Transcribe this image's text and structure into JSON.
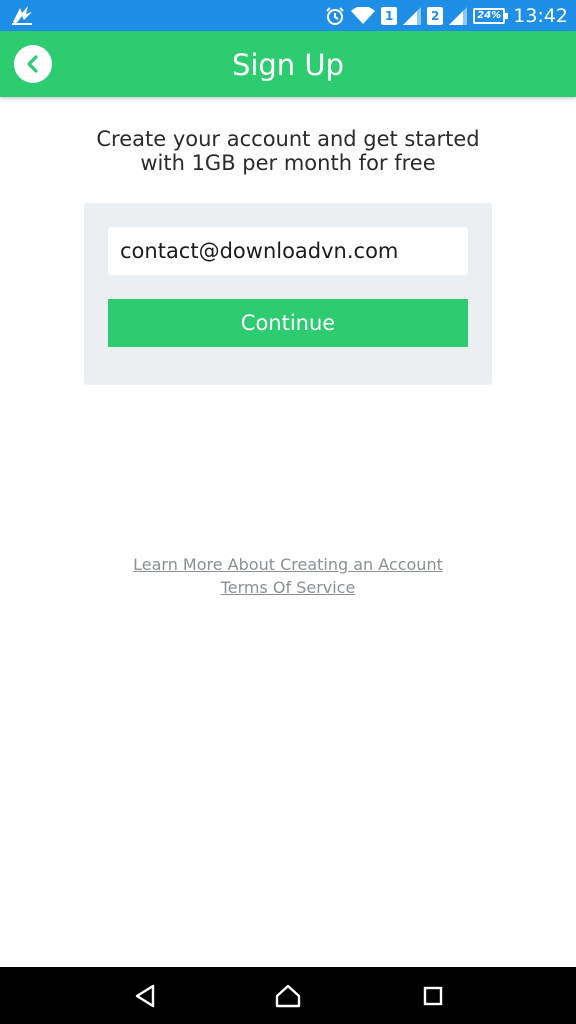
{
  "status_bar": {
    "sim1_label": "1",
    "sim2_label": "2",
    "battery_text": "24%",
    "time": "13:42"
  },
  "header": {
    "title": "Sign Up"
  },
  "tagline": {
    "line1": "Create your account and get started",
    "line2": "with 1GB per month for free"
  },
  "form": {
    "email_value": "contact@downloadvn.com",
    "continue_label": "Continue"
  },
  "links": {
    "learn_more": "Learn More About Creating an Account",
    "terms": "Terms Of Service"
  },
  "colors": {
    "status_bar": "#1e8ee6",
    "accent_green": "#2ecc71",
    "panel_bg": "#eceff1",
    "link_gray": "#8a9094"
  },
  "icons": {
    "app": "app-logo-icon",
    "alarm": "alarm-icon",
    "wifi": "wifi-icon",
    "signal": "signal-icon",
    "back": "chevron-left-icon",
    "nav_back": "nav-back-icon",
    "nav_home": "nav-home-icon",
    "nav_recents": "nav-recents-icon"
  }
}
